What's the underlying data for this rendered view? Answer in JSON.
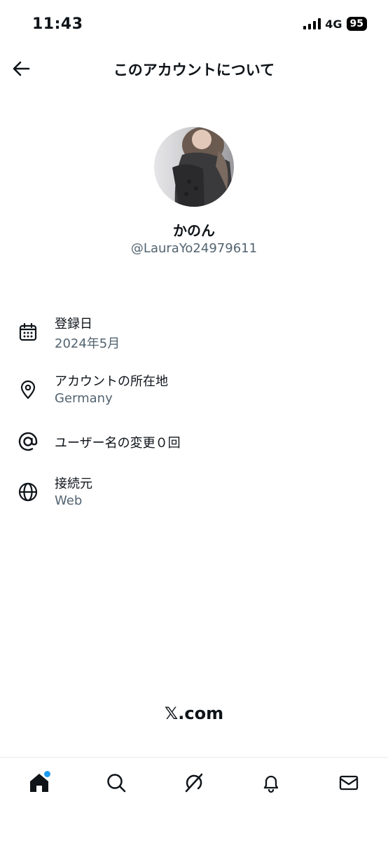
{
  "status_bar": {
    "time": "11:43",
    "network": "4G",
    "battery": "95"
  },
  "header": {
    "back_icon": "arrow-left-icon",
    "title": "このアカウントについて"
  },
  "profile": {
    "display_name": "かのん",
    "handle": "@LauraYo24979611"
  },
  "info": [
    {
      "icon": "calendar-icon",
      "label": "登録日",
      "value": "2024年5月"
    },
    {
      "icon": "location-pin-icon",
      "label": "アカウントの所在地",
      "value": "Germany"
    },
    {
      "icon": "at-sign-icon",
      "label": "ユーザー名の変更０回"
    },
    {
      "icon": "globe-icon",
      "label": "接続元",
      "value": "Web"
    }
  ],
  "footer": {
    "brand": "𝕏.com"
  },
  "bottom_nav": {
    "items": [
      "home-icon",
      "search-icon",
      "grok-icon",
      "bell-icon",
      "mail-icon"
    ],
    "home_badge_color": "#1d9bf0"
  },
  "colors": {
    "text": "#0f1419",
    "secondary": "#536471",
    "accent": "#1d9bf0"
  }
}
